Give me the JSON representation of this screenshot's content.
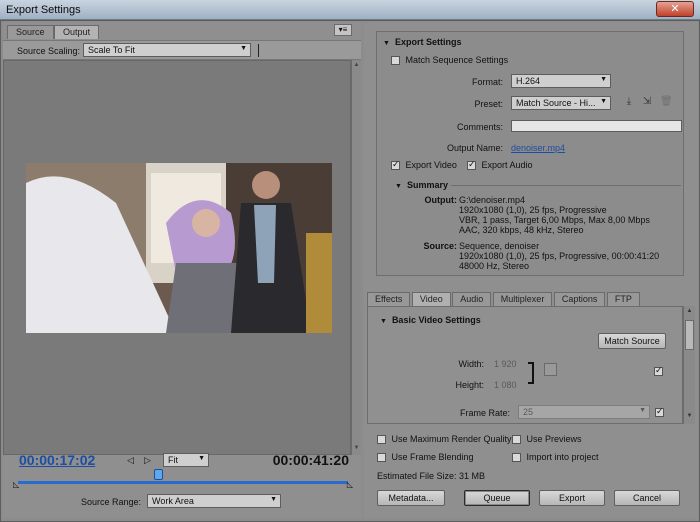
{
  "window": {
    "title": "Export Settings",
    "close_glyph": "✕"
  },
  "left": {
    "tabs": [
      {
        "label": "Source"
      },
      {
        "label": "Output"
      }
    ],
    "panel_menu_glyph": "▾≡",
    "source_scaling_label": "Source Scaling:",
    "source_scaling_value": "Scale To Fit",
    "timecode_current": "00:00:17:02",
    "timecode_total": "00:00:41:20",
    "zoom_value": "Fit",
    "source_range_label": "Source Range:",
    "source_range_value": "Work Area"
  },
  "export_settings": {
    "header": "Export Settings",
    "match_sequence_label": "Match Sequence Settings",
    "format_label": "Format:",
    "format_value": "H.264",
    "preset_label": "Preset:",
    "preset_value": "Match Source - Hi...",
    "comments_label": "Comments:",
    "comments_value": "",
    "output_name_label": "Output Name:",
    "output_name_value": "denoiser.mp4",
    "export_video_label": "Export Video",
    "export_audio_label": "Export Audio",
    "summary_header": "Summary",
    "output_key": "Output:",
    "output_lines": [
      "G:\\denoiser.mp4",
      "1920x1080 (1,0), 25 fps, Progressive",
      "VBR, 1 pass, Target 6,00 Mbps, Max 8,00 Mbps",
      "AAC, 320 kbps, 48 kHz, Stereo"
    ],
    "source_key": "Source:",
    "source_lines": [
      "Sequence, denoiser",
      "1920x1080 (1,0), 25 fps, Progressive, 00:00:41:20",
      "48000 Hz, Stereo"
    ]
  },
  "settings_tabs": [
    {
      "label": "Effects"
    },
    {
      "label": "Video"
    },
    {
      "label": "Audio"
    },
    {
      "label": "Multiplexer"
    },
    {
      "label": "Captions"
    },
    {
      "label": "FTP"
    }
  ],
  "basic_video": {
    "header": "Basic Video Settings",
    "match_source_button": "Match Source",
    "width_label": "Width:",
    "width_value": "1 920",
    "height_label": "Height:",
    "height_value": "1 080",
    "frame_rate_label": "Frame Rate:",
    "frame_rate_value": "25"
  },
  "options": {
    "max_render_quality": "Use Maximum Render Quality",
    "use_previews": "Use Previews",
    "frame_blending": "Use Frame Blending",
    "import_into_project": "Import into project",
    "estimated_file_size": "Estimated File Size:  31 MB"
  },
  "buttons": {
    "metadata": "Metadata...",
    "queue": "Queue",
    "export": "Export",
    "cancel": "Cancel"
  }
}
